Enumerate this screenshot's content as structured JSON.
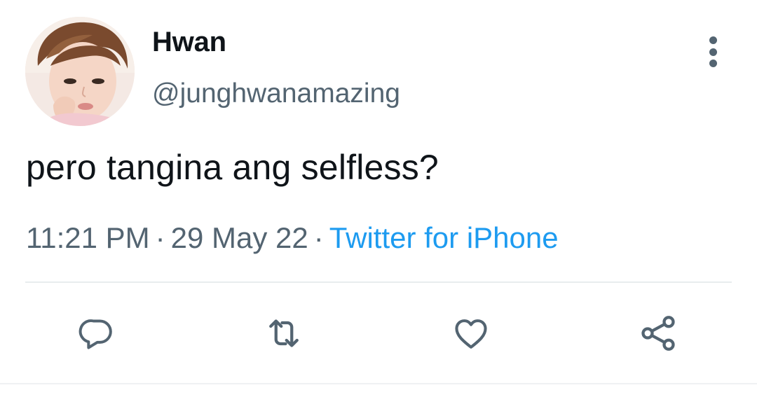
{
  "tweet": {
    "author": {
      "display_name": "Hwan",
      "handle": "@junghwanamazing"
    },
    "text": "pero tangina ang selfless?",
    "time": "11:21 PM",
    "separator": "·",
    "date": "29 May 22",
    "source": "Twitter for iPhone"
  },
  "icons": {
    "more": "more-vertical-icon",
    "reply": "reply-icon",
    "retweet": "retweet-icon",
    "like": "heart-icon",
    "share": "share-icon"
  },
  "colors": {
    "text": "#0f1419",
    "secondary": "#536471",
    "accent": "#1d9bf0",
    "divider": "#e8ecee"
  }
}
